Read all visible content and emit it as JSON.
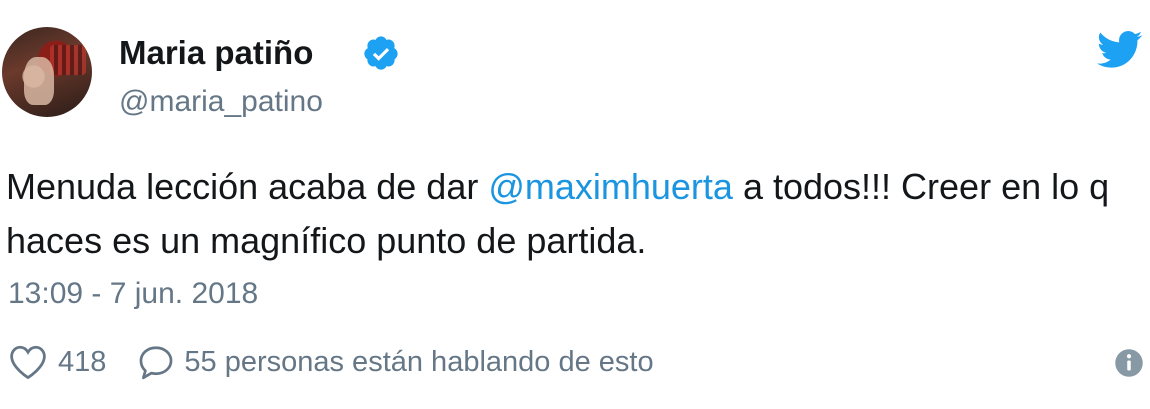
{
  "tweet": {
    "display_name": "Maria patiño",
    "handle": "@maria_patino",
    "text_before": "Menuda lección acaba de dar ",
    "mention": "@maximhuerta",
    "text_after": " a todos!!! Creer en lo q haces es un magnífico punto de partida.",
    "timestamp": "13:09 - 7 jun. 2018",
    "like_count": "418",
    "conversation_label": "55 personas están hablando de esto"
  },
  "icons": {
    "verified": "verified-badge-icon",
    "brand": "twitter-bird-icon",
    "like": "heart-icon",
    "reply": "speech-bubble-icon",
    "info": "info-icon"
  },
  "colors": {
    "brand_blue": "#1da1f2",
    "mention_blue": "#1b95e0",
    "muted": "#657786",
    "text": "#14171a"
  }
}
